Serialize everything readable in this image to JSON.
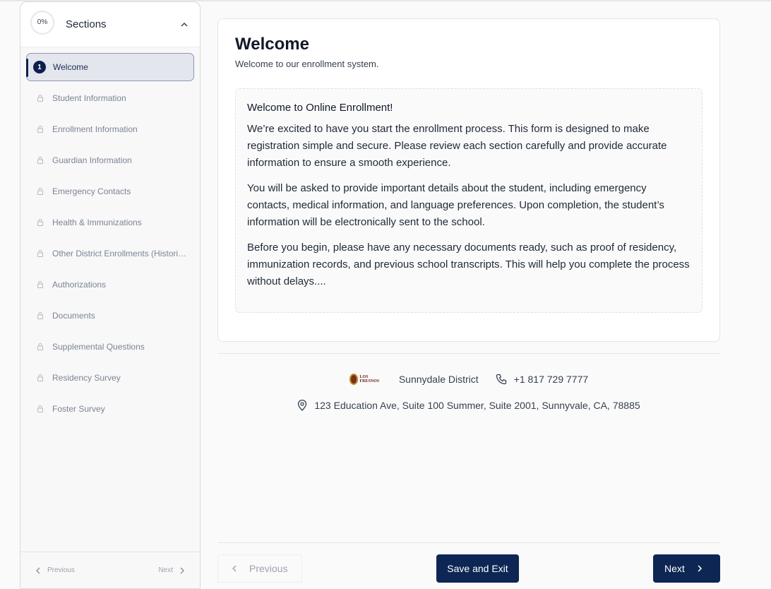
{
  "sidebar": {
    "progress": "0%",
    "title": "Sections",
    "items": [
      {
        "label": "Welcome",
        "step": "1",
        "active": true
      },
      {
        "label": "Student Information"
      },
      {
        "label": "Enrollment Information"
      },
      {
        "label": "Guardian Information"
      },
      {
        "label": "Emergency Contacts"
      },
      {
        "label": "Health & Immunizations"
      },
      {
        "label": "Other District Enrollments (Historical)"
      },
      {
        "label": "Authorizations"
      },
      {
        "label": "Documents"
      },
      {
        "label": "Supplemental Questions"
      },
      {
        "label": "Residency Survey"
      },
      {
        "label": "Foster Survey"
      }
    ],
    "footer": {
      "prev_label": "Previous",
      "next_label": "Next"
    }
  },
  "main": {
    "title": "Welcome",
    "subtitle": "Welcome to our enrollment system.",
    "welcome_box": {
      "heading": "Welcome to Online Enrollment!",
      "paragraphs": [
        "We’re excited to have you start the enrollment process. This form is designed to make registration simple and secure. Please review each section carefully and provide accurate information to ensure a smooth experience.",
        "You will be asked to provide important details about the student, including emergency contacts, medical information, and language preferences. Upon completion, the student’s information will be electronically sent to the school.",
        "Before you begin, please have any necessary documents ready, such as proof of residency, immunization records, and previous school transcripts. This will help you complete the process without delays...."
      ]
    }
  },
  "footer_info": {
    "logo_text": "LOS FRESNOS",
    "district": "Sunnydale District",
    "phone": "+1 817 729 7777",
    "address": "123 Education Ave, Suite 100 Summer, Suite 2001, Sunnyvale, CA, 78885"
  },
  "actions": {
    "previous_label": "Previous",
    "save_label": "Save and Exit",
    "next_label": "Next"
  },
  "colors": {
    "primary": "#0d2654",
    "active_bg": "#e3e6ed"
  }
}
